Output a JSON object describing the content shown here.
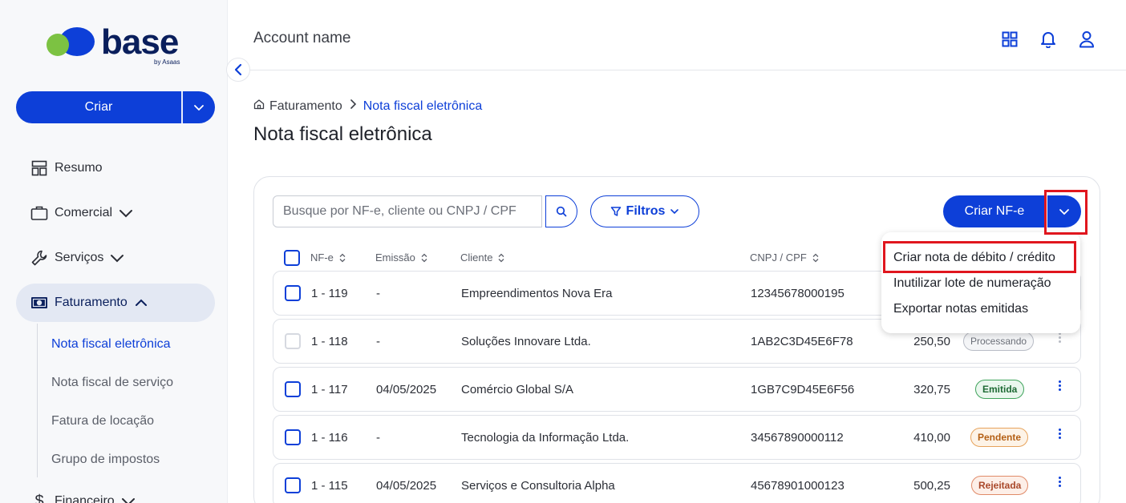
{
  "app": {
    "logo_word": "base",
    "logo_tag": "by Asaas"
  },
  "sidebar": {
    "create_label": "Criar",
    "items": [
      {
        "label": "Resumo",
        "icon": "layout-icon"
      },
      {
        "label": "Comercial",
        "icon": "briefcase-icon"
      },
      {
        "label": "Serviços",
        "icon": "wrench-icon"
      },
      {
        "label": "Faturamento",
        "icon": "money-icon"
      },
      {
        "label": "Financeiro",
        "icon": "dollar-icon"
      }
    ],
    "subitems": [
      "Nota fiscal eletrônica",
      "Nota fiscal de serviço",
      "Fatura de locação",
      "Grupo de impostos"
    ]
  },
  "header": {
    "account": "Account name",
    "icons": [
      "grid-icon",
      "bell-icon",
      "user-icon"
    ]
  },
  "breadcrumb": {
    "root": "Faturamento",
    "current": "Nota fiscal eletrônica"
  },
  "page": {
    "title": "Nota fiscal eletrônica"
  },
  "toolbar": {
    "search_placeholder": "Busque por NF-e, cliente ou CNPJ / CPF",
    "filters_label": "Filtros",
    "create_nfe_label": "Criar NF-e"
  },
  "menu": [
    "Criar nota de débito / crédito",
    "Inutilizar lote de numeração",
    "Exportar notas emitidas"
  ],
  "table": {
    "headers": [
      "NF-e",
      "Emissão",
      "Cliente",
      "CNPJ / CPF"
    ],
    "rows": [
      {
        "nf": "1 - 119",
        "emissao": "-",
        "cliente": "Empreendimentos Nova Era",
        "cnpj": "12345678000195",
        "valor": "",
        "status": ""
      },
      {
        "nf": "1 - 118",
        "emissao": "-",
        "cliente": "Soluções Innovare Ltda.",
        "cnpj": "1AB2C3D45E6F78",
        "valor": "250,50",
        "status": "Processando"
      },
      {
        "nf": "1 - 117",
        "emissao": "04/05/2025",
        "cliente": "Comércio Global S/A",
        "cnpj": "1GB7C9D45E6F56",
        "valor": "320,75",
        "status": "Emitida"
      },
      {
        "nf": "1 -  116",
        "emissao": "-",
        "cliente": "Tecnologia da Informação Ltda.",
        "cnpj": "34567890000112",
        "valor": "410,00",
        "status": "Pendente"
      },
      {
        "nf": "1 - 115",
        "emissao": "04/05/2025",
        "cliente": "Serviços e Consultoria Alpha",
        "cnpj": "45678901000123",
        "valor": "500,25",
        "status": "Rejeitada"
      }
    ]
  },
  "colors": {
    "primary": "#0d3fd8",
    "highlight": "#e0161e",
    "emitida": "#1e8a3a",
    "pendente": "#d9822b",
    "rejeitada": "#b8572e",
    "processando": "#6b6f78"
  }
}
